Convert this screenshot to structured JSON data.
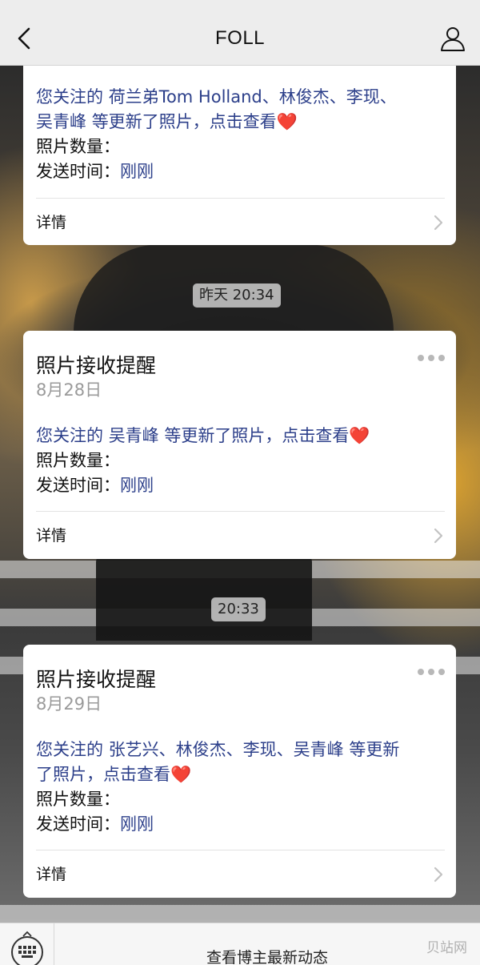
{
  "header": {
    "title": "FOLL",
    "back_icon": "chevron-left-icon",
    "profile_icon": "person-icon"
  },
  "cards": [
    {
      "intro": "您关注的 ",
      "names_line1": "荷兰弟Tom Holland、林俊杰、李现、",
      "names_line2": "吴青峰 ",
      "update_text": "等更新了照片，点击查看",
      "heart": "❤️",
      "count_label": "照片数量：",
      "time_label": "发送时间：",
      "time_value": "刚刚",
      "detail_label": "详情"
    },
    {
      "title": "照片接收提醒",
      "date": "8月28日",
      "intro": "您关注的 ",
      "names": "吴青峰 ",
      "update_text": "等更新了照片，点击查看",
      "heart": "❤️",
      "count_label": "照片数量：",
      "time_label": "发送时间：",
      "time_value": "刚刚",
      "detail_label": "详情"
    },
    {
      "title": "照片接收提醒",
      "date": "8月29日",
      "intro": "您关注的 ",
      "names": "张艺兴、林俊杰、李现、吴青峰 ",
      "update_line1": "等更新",
      "update_line2": "了照片，点击查看",
      "heart": "❤️",
      "count_label": "照片数量：",
      "time_label": "发送时间：",
      "time_value": "刚刚",
      "detail_label": "详情"
    }
  ],
  "timestamps": [
    "昨天 20:34",
    "20:33"
  ],
  "bottom_bar": {
    "action_label": "查看博主最新动态",
    "keyboard_icon": "keyboard-icon",
    "watermark": "贝站网"
  },
  "colors": {
    "link": "#2c3f8a",
    "heart": "#e0242c",
    "header_bg": "#ededed"
  }
}
